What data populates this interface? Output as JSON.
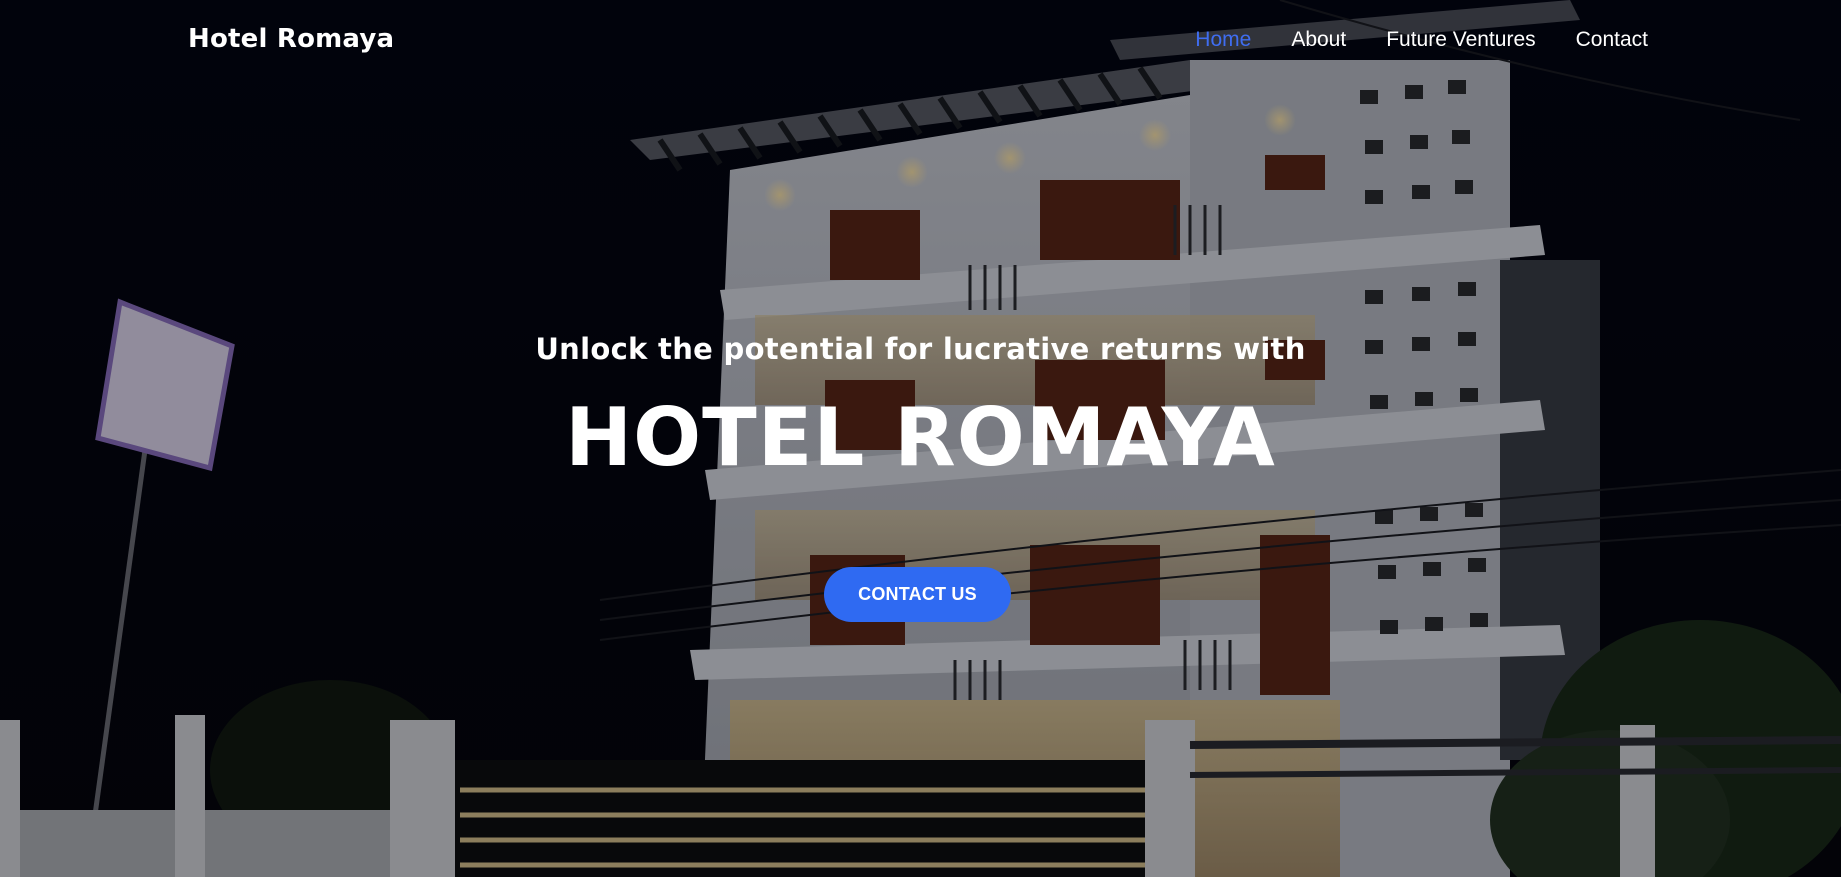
{
  "header": {
    "brand": "Hotel Romaya",
    "nav": [
      {
        "label": "Home",
        "active": true
      },
      {
        "label": "About",
        "active": false
      },
      {
        "label": "Future Ventures",
        "active": false
      },
      {
        "label": "Contact",
        "active": false
      }
    ]
  },
  "hero": {
    "subtitle": "Unlock the potential for lucrative returns with",
    "title": "HOTEL ROMAYA",
    "cta_label": "CONTACT US",
    "background_image": "hotel-building-night-photo"
  },
  "colors": {
    "accent": "#2f6af2",
    "nav_active": "#3f6df0",
    "text": "#ffffff",
    "background": "#02030a"
  }
}
